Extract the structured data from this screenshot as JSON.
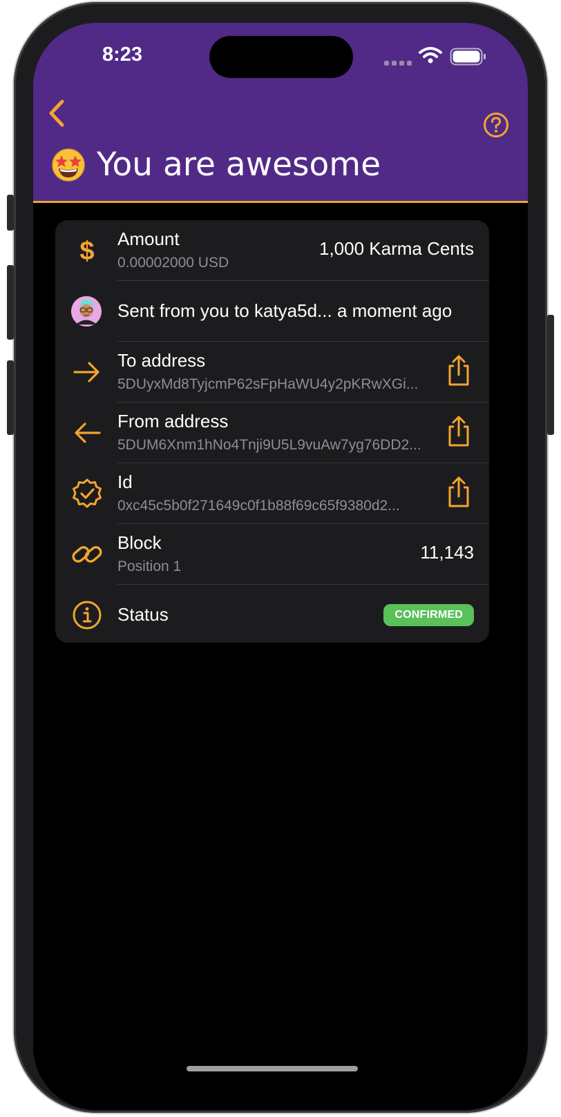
{
  "status_bar": {
    "time": "8:23"
  },
  "header": {
    "title": "You are awesome"
  },
  "rows": {
    "amount": {
      "label": "Amount",
      "sub": "0.00002000 USD",
      "value": "1,000 Karma Cents"
    },
    "sent": {
      "text": "Sent from you to katya5d... a moment ago"
    },
    "to_address": {
      "label": "To address",
      "value": "5DUyxMd8TyjcmP62sFpHaWU4y2pKRwXGi..."
    },
    "from_address": {
      "label": "From address",
      "value": "5DUM6Xnm1hNo4Tnji9U5L9vuAw7yg76DD2..."
    },
    "id": {
      "label": "Id",
      "value": "0xc45c5b0f271649c0f1b88f69c65f9380d2..."
    },
    "block": {
      "label": "Block",
      "sub": "Position 1",
      "value": "11,143"
    },
    "status": {
      "label": "Status",
      "badge": "CONFIRMED"
    }
  },
  "icons": {
    "back": "chevron-left-icon",
    "help": "question-circle-icon",
    "amount": "dollar-icon",
    "to": "arrow-right-icon",
    "from": "arrow-left-icon",
    "id": "verified-badge-icon",
    "block": "link-icon",
    "status": "info-circle-icon",
    "share": "share-icon"
  },
  "colors": {
    "header_bg": "#512a87",
    "accent": "#f3a530",
    "card_bg": "#1c1c1e",
    "badge_green": "#5ac05a"
  }
}
